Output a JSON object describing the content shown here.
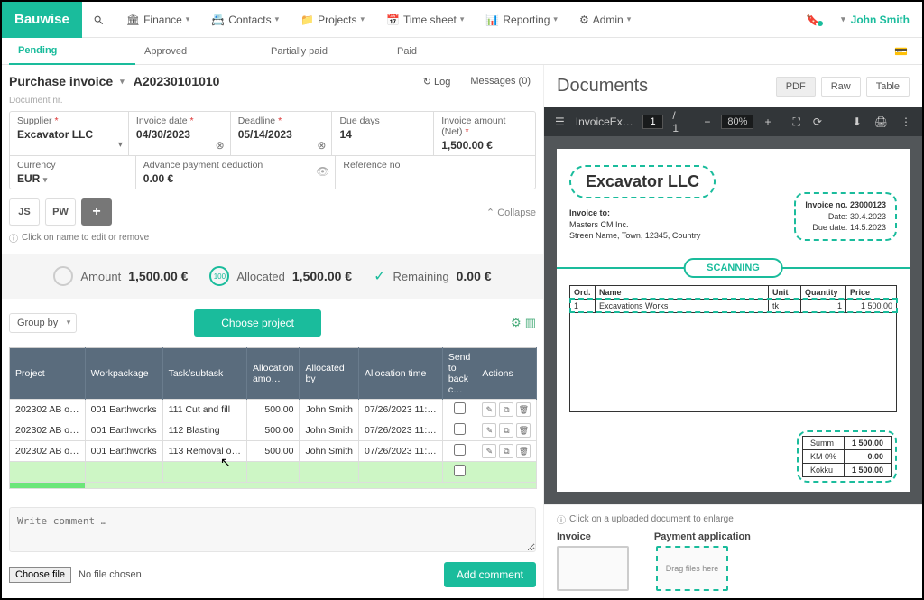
{
  "brand": "Bauwise",
  "nav": {
    "finance": "Finance",
    "contacts": "Contacts",
    "projects": "Projects",
    "timesheet": "Time sheet",
    "reporting": "Reporting",
    "admin": "Admin"
  },
  "user": "John Smith",
  "statusTabs": {
    "pending": "Pending",
    "approved": "Approved",
    "partial": "Partially paid",
    "paid": "Paid"
  },
  "invoice": {
    "type": "Purchase invoice",
    "number": "A20230101010",
    "docnr_label": "Document nr.",
    "log": "Log",
    "messages": "Messages (0)"
  },
  "fields": {
    "supplier": {
      "label": "Supplier",
      "value": "Excavator LLC"
    },
    "invoiceDate": {
      "label": "Invoice date",
      "value": "04/30/2023"
    },
    "deadline": {
      "label": "Deadline",
      "value": "05/14/2023"
    },
    "dueDays": {
      "label": "Due days",
      "value": "14"
    },
    "invoiceAmount": {
      "label": "Invoice amount (Net)",
      "value": "1,500.00 €"
    },
    "currency": {
      "label": "Currency",
      "value": "EUR"
    },
    "advance": {
      "label": "Advance payment deduction",
      "value": "0.00 €"
    },
    "reference": {
      "label": "Reference no",
      "value": ""
    }
  },
  "avatars": {
    "a1": "JS",
    "a2": "PW"
  },
  "collapse": "Collapse",
  "hint": "Click on name to edit or remove",
  "summary": {
    "amountLabel": "Amount",
    "amountValue": "1,500.00 €",
    "allocatedLabel": "Allocated",
    "allocatedValue": "1,500.00 €",
    "remainingLabel": "Remaining",
    "remainingValue": "0.00 €",
    "circleText": "100"
  },
  "groupBy": "Group by",
  "chooseProject": "Choose project",
  "allocTable": {
    "headers": {
      "project": "Project",
      "wp": "Workpackage",
      "task": "Task/subtask",
      "amount": "Allocation amo…",
      "by": "Allocated by",
      "time": "Allocation time",
      "send": "Send to back c…",
      "actions": "Actions"
    },
    "rows": [
      {
        "project": "202302 AB o…",
        "wp": "001 Earthworks",
        "task": "111 Cut and fill",
        "amount": "500.00",
        "by": "John Smith",
        "time": "07/26/2023 11:…"
      },
      {
        "project": "202302 AB o…",
        "wp": "001 Earthworks",
        "task": "112 Blasting",
        "amount": "500.00",
        "by": "John Smith",
        "time": "07/26/2023 11:…"
      },
      {
        "project": "202302 AB o…",
        "wp": "001 Earthworks",
        "task": "113 Removal o…",
        "amount": "500.00",
        "by": "John Smith",
        "time": "07/26/2023 11:…"
      }
    ]
  },
  "comment": {
    "placeholder": "Write comment …",
    "chooseFile": "Choose file",
    "noFile": "No file chosen",
    "add": "Add comment"
  },
  "docs": {
    "title": "Documents",
    "views": {
      "pdf": "PDF",
      "raw": "Raw",
      "table": "Table"
    }
  },
  "pdfbar": {
    "filename": "InvoiceEx…",
    "page": "1",
    "pages": "1",
    "zoom": "80%"
  },
  "pdf": {
    "company": "Excavator LLC",
    "invoiceTo": "Invoice to:",
    "client": "Masters CM Inc.",
    "address": "Streen Name, Town, 12345, Country",
    "invNoLabel": "Invoice no.",
    "invNo": "23000123",
    "dateLabel": "Date:",
    "date": "30.4.2023",
    "dueLabel": "Due date:",
    "due": "14.5.2023",
    "scanning": "SCANNING",
    "headers": {
      "ord": "Ord.",
      "name": "Name",
      "unit": "Unit",
      "qty": "Quantity",
      "price": "Price"
    },
    "item": {
      "ord": "1",
      "name": "Excavations Works",
      "unit": "tk",
      "qty": "1",
      "price": "1 500.00"
    },
    "totals": {
      "summ": "Summ",
      "summV": "1 500.00",
      "km": "KM 0%",
      "kmV": "0.00",
      "kokku": "Kokku",
      "kokkuV": "1 500.00"
    }
  },
  "footer": {
    "hint": "Click on a uploaded document to enlarge",
    "invoice": "Invoice",
    "payment": "Payment application",
    "drag": "Drag files here"
  }
}
